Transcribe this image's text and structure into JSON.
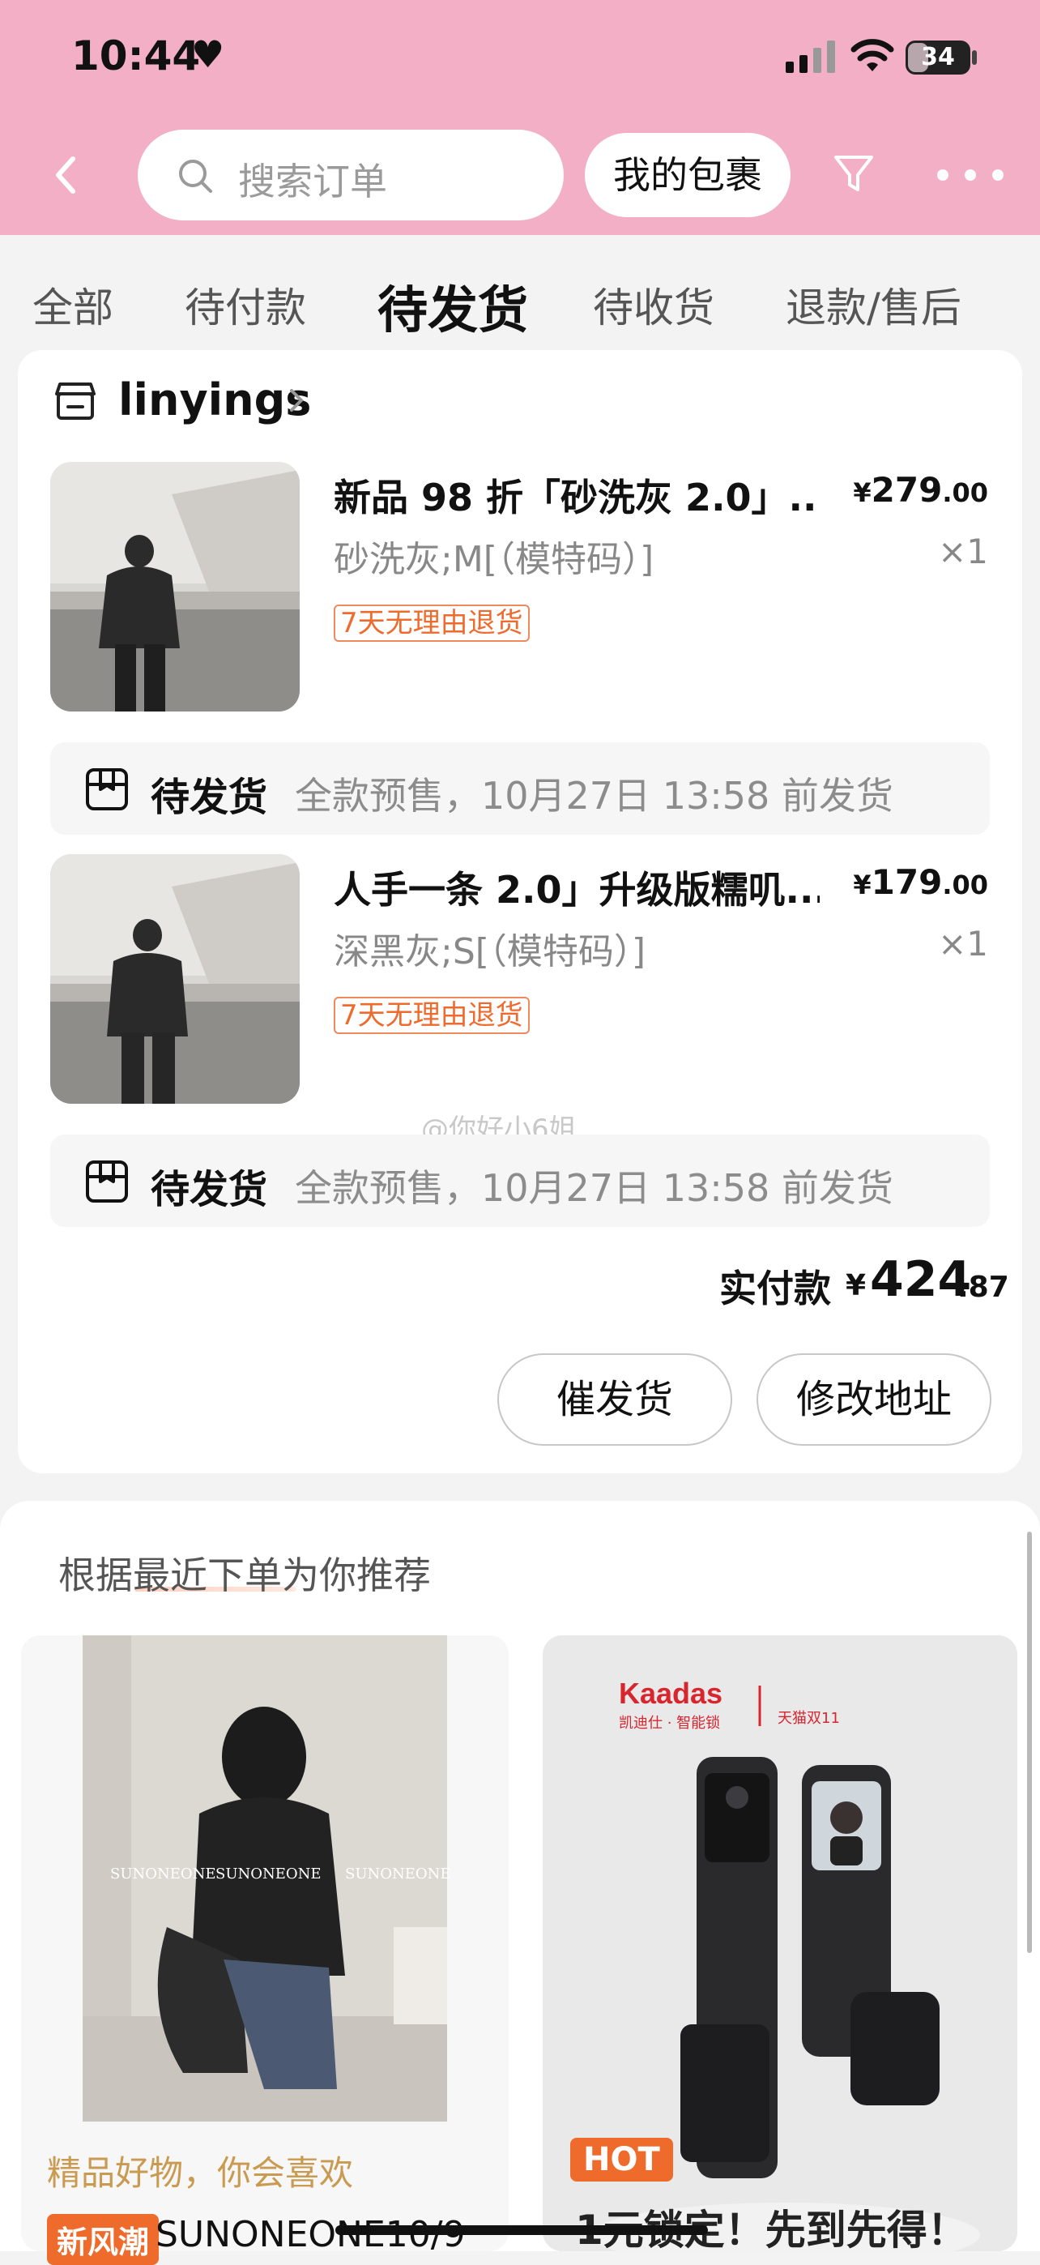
{
  "status_bar": {
    "time": "10:44",
    "battery": "34",
    "battery_level": 0.34
  },
  "header": {
    "search_placeholder": "搜索订单",
    "package_button": "我的包裹"
  },
  "tabs": [
    {
      "label": "全部",
      "active": false
    },
    {
      "label": "待付款",
      "active": false
    },
    {
      "label": "待发货",
      "active": true
    },
    {
      "label": "待收货",
      "active": false
    },
    {
      "label": "退款/售后",
      "active": false
    }
  ],
  "order": {
    "shop_name": "linyings",
    "items": [
      {
        "title": "新品 98 折「砂洗灰 2.0」...",
        "spec": "砂洗灰;M[（模特码）]",
        "price_yen": "¥",
        "price_int": "279",
        "price_dec": ".00",
        "qty": "×1",
        "tag": "7天无理由退货",
        "ship_status": "待发货",
        "ship_note": "全款预售，10月27日 13:58 前发货"
      },
      {
        "title": "人手一条 2.0」升级版糯叽...",
        "spec": "深黑灰;S[（模特码）]",
        "price_yen": "¥",
        "price_int": "179",
        "price_dec": ".00",
        "qty": "×1",
        "tag": "7天无理由退货",
        "ship_status": "待发货",
        "ship_note": "全款预售，10月27日 13:58 前发货"
      }
    ],
    "watermark": "@你好小6姐",
    "paid_label": "实付款",
    "paid_yen": "¥",
    "paid_int": "424",
    "paid_dec": ".87",
    "buttons": {
      "urge": "催发货",
      "edit_address": "修改地址"
    }
  },
  "recommend": {
    "title": "根据最近下单为你推荐",
    "left_item": {
      "subtitle": "精品好物，你会喜欢",
      "badge": "新风潮",
      "brand": "SUNONEONE10/9",
      "image_watermark": "SUNONEONE"
    },
    "right_item": {
      "brand_logo": "Kaadas",
      "brand_sub": "凯迪仕 · 智能锁",
      "campaign": "天猫双11",
      "badge": "HOT",
      "promo": "1元锁定！先到先得！"
    }
  },
  "colors": {
    "header_pink": "#f2afc6",
    "tag_orange": "#ee6a2d",
    "subtitle_gold": "#c99a4f"
  }
}
